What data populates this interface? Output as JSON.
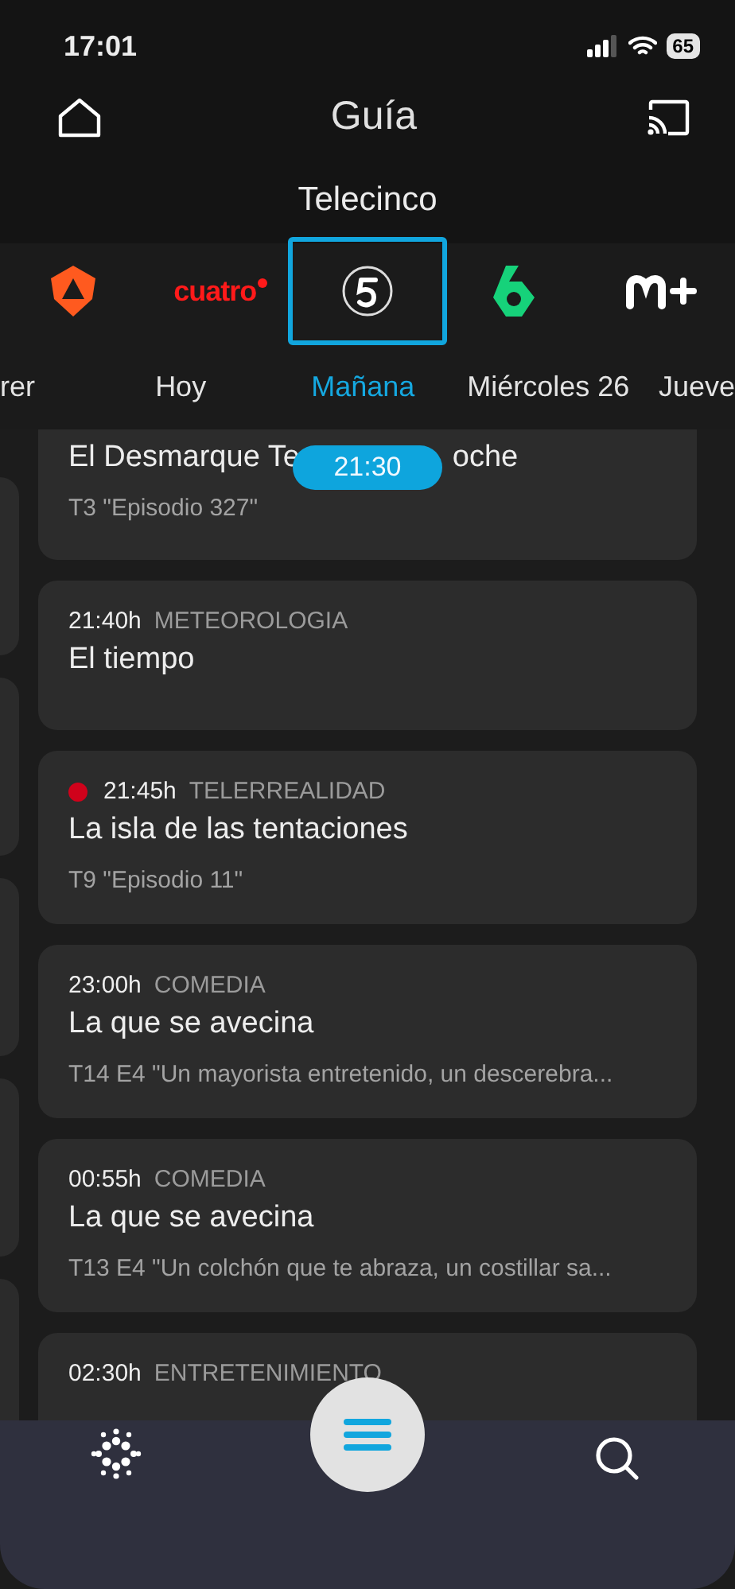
{
  "status_bar": {
    "time": "17:01",
    "battery": "65"
  },
  "header": {
    "title": "Guía"
  },
  "channel_name": "Telecinco",
  "channels": [
    {
      "kind": "antena",
      "selected": false
    },
    {
      "kind": "cuatro",
      "label": "cuatro",
      "selected": false
    },
    {
      "kind": "cinco",
      "selected": true
    },
    {
      "kind": "sexta",
      "selected": false
    },
    {
      "kind": "mplus",
      "selected": false
    }
  ],
  "days": [
    {
      "label": "rer",
      "selected": false
    },
    {
      "label": "Hoy",
      "selected": false
    },
    {
      "label": "Mañana",
      "selected": true
    },
    {
      "label": "Miércoles 26",
      "selected": false
    },
    {
      "label": "Jueve",
      "selected": false
    }
  ],
  "now_marker": "21:30",
  "programs": [
    {
      "title_parts": [
        "El Desmarque Te",
        "oche"
      ],
      "subtitle": "T3 \"Episodio 327\"",
      "live": false
    },
    {
      "time": "21:40h",
      "genre": "METEOROLOGIA",
      "title": "El tiempo",
      "live": false
    },
    {
      "time": "21:45h",
      "genre": "TELERREALIDAD",
      "title": "La isla de las tentaciones",
      "subtitle": "T9 \"Episodio 11\"",
      "live": true
    },
    {
      "time": "23:00h",
      "genre": "COMEDIA",
      "title": "La que se avecina",
      "subtitle": "T14 E4 \"Un mayorista entretenido, un descerebra...",
      "live": false
    },
    {
      "time": "00:55h",
      "genre": "COMEDIA",
      "title": "La que se avecina",
      "subtitle": "T13 E4 \"Un colchón que te abraza, un costillar sa...",
      "live": false
    },
    {
      "time": "02:30h",
      "genre": "ENTRETENIMIENTO",
      "live": false
    }
  ]
}
